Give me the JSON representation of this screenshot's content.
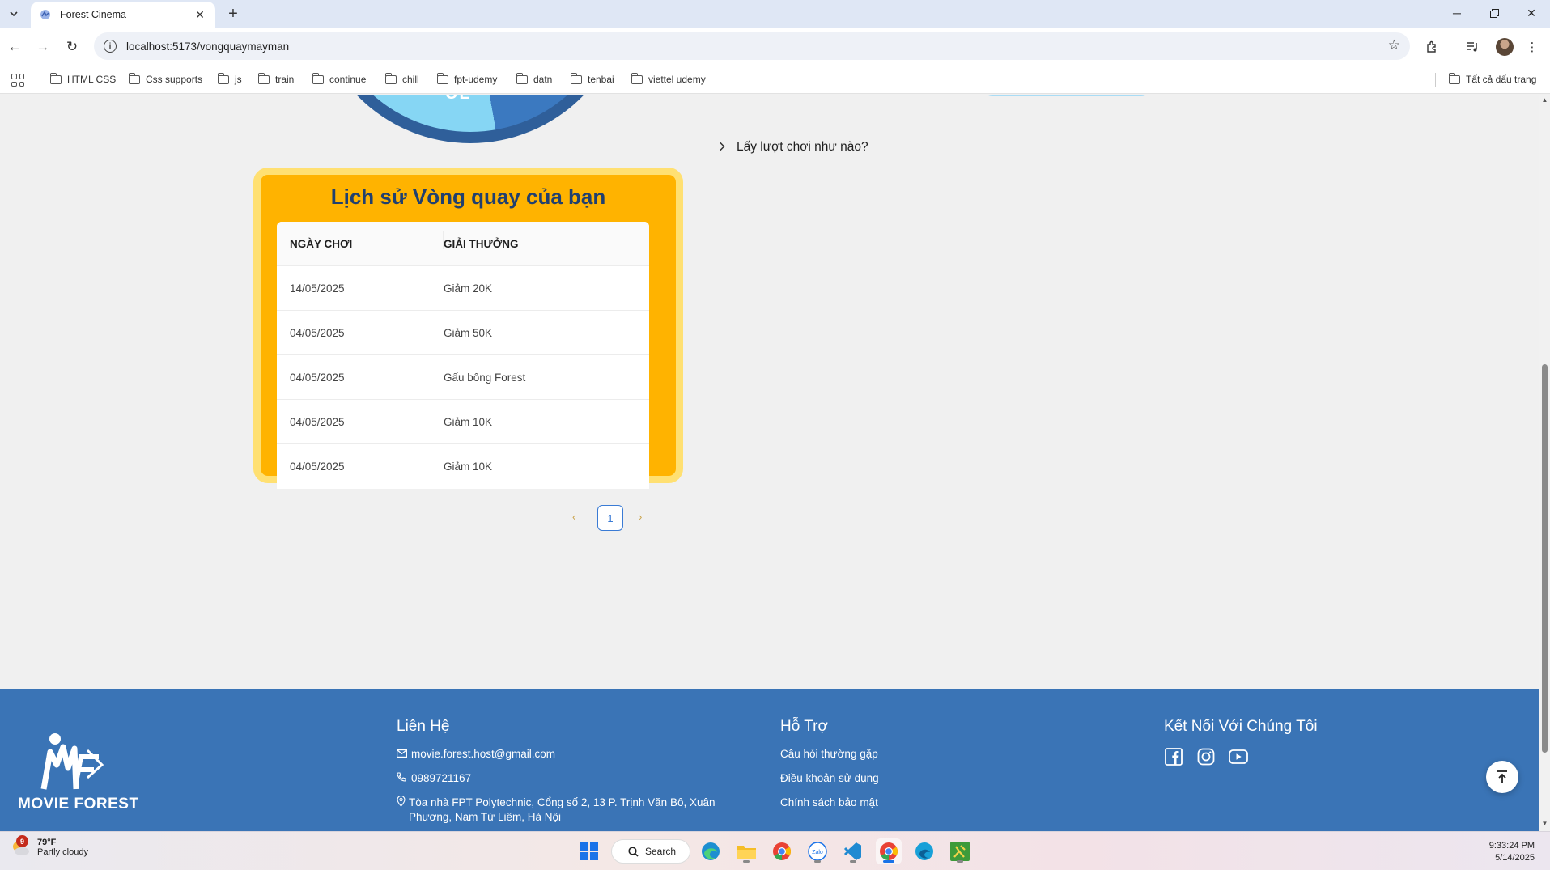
{
  "browser": {
    "tab_title": "Forest Cinema",
    "url": "localhost:5173/vongquaymayman",
    "bookmarks": [
      "HTML CSS",
      "Css supports",
      "js",
      "train",
      "continue",
      "chill",
      "fpt-udemy",
      "datn",
      "tenbai",
      "viettel udemy"
    ],
    "all_bookmarks": "Tất cả dấu trang"
  },
  "page": {
    "wheel_partial_text": "OL",
    "how_to_play": "Lấy lượt chơi như nào?",
    "history": {
      "title": "Lịch sử Vòng quay của bạn",
      "columns": [
        "NGÀY CHƠI",
        "GIẢI THƯỞNG"
      ],
      "rows": [
        {
          "date": "14/05/2025",
          "prize": "Giảm 20K"
        },
        {
          "date": "04/05/2025",
          "prize": "Giảm 50K"
        },
        {
          "date": "04/05/2025",
          "prize": "Gấu bông Forest"
        },
        {
          "date": "04/05/2025",
          "prize": "Giảm 10K"
        },
        {
          "date": "04/05/2025",
          "prize": "Giảm 10K"
        }
      ],
      "pagination": {
        "current_page": "1",
        "prev": "‹",
        "next": "›"
      }
    }
  },
  "footer": {
    "brand": "MOVIE FOREST",
    "contact": {
      "title": "Liên Hệ",
      "email": "movie.forest.host@gmail.com",
      "phone": "0989721167",
      "address": "Tòa nhà FPT Polytechnic, Cổng số 2, 13 P. Trịnh Văn Bô, Xuân Phương, Nam Từ Liêm, Hà Nội"
    },
    "support": {
      "title": "Hỗ Trợ",
      "links": [
        "Câu hỏi thường gặp",
        "Điều khoản sử dụng",
        "Chính sách bảo mật"
      ]
    },
    "connect": {
      "title": "Kết Nối Với Chúng Tôi",
      "icons": [
        "facebook-icon",
        "instagram-icon",
        "youtube-icon"
      ]
    }
  },
  "taskbar": {
    "weather_temp": "79°F",
    "weather_desc": "Partly cloudy",
    "weather_badge": "9",
    "search_label": "Search",
    "time": "9:33:24 PM",
    "date": "5/14/2025"
  },
  "colors": {
    "history_bg": "#ffb300",
    "history_border": "#ffe072",
    "history_title": "#21406f",
    "footer_bg": "#3a74b6",
    "accent": "#3a7bd5"
  }
}
